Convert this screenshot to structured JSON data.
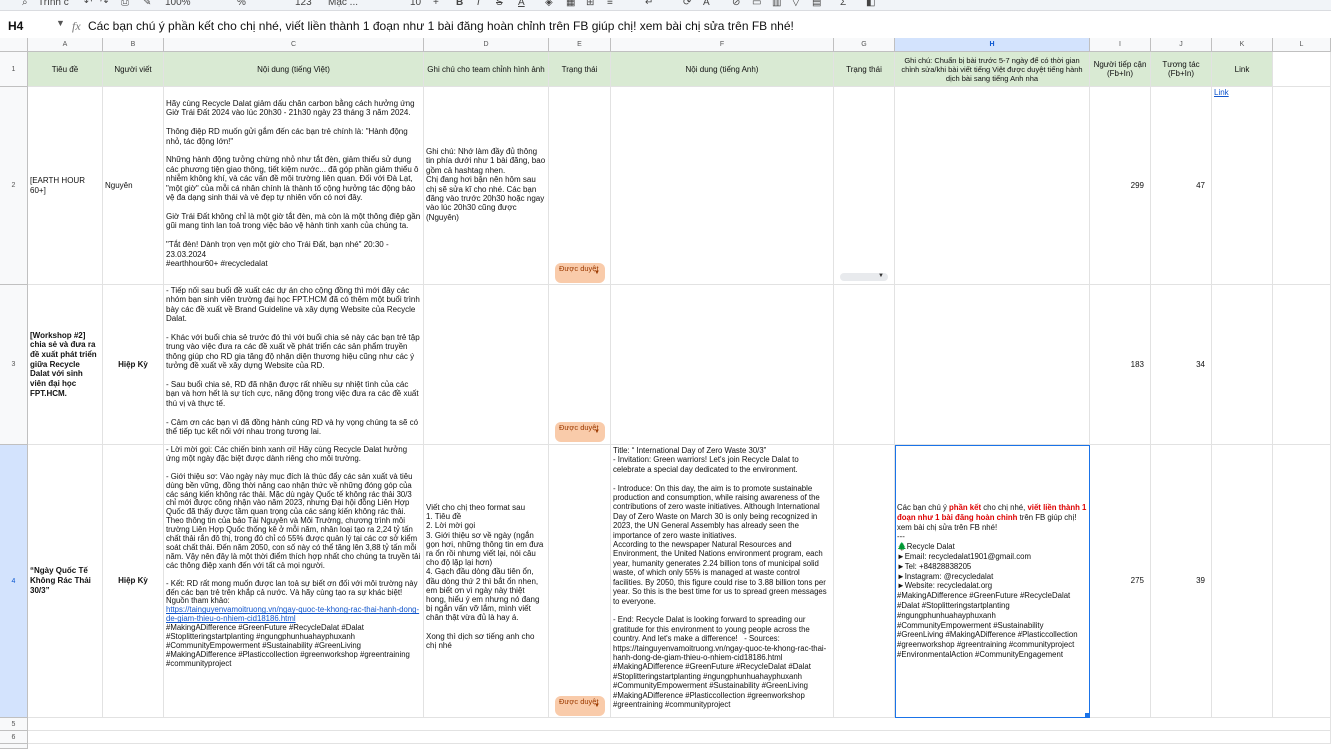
{
  "toolbar": {
    "search": "Trình c",
    "zoom": "100%",
    "font_family": "Mặc ...",
    "font_size": "10",
    "number_format": "123"
  },
  "formula_bar": {
    "cell_ref": "H4",
    "content": "Các bạn chú ý phần kết cho chị nhé, viết liền thành 1 đoạn như 1 bài đăng hoàn chỉnh trên FB giúp chị! xem bài chị sửa trên FB nhé!"
  },
  "columns": [
    "A",
    "B",
    "C",
    "D",
    "E",
    "F",
    "G",
    "H",
    "I",
    "J",
    "K",
    "L"
  ],
  "row_numbers": [
    "1",
    "2",
    "3",
    "4",
    "5",
    "6"
  ],
  "headers": {
    "A": "Tiêu đề",
    "B": "Người viết",
    "C": "Nội dung (tiếng Việt)",
    "D": "Ghi chú cho team chỉnh hình ảnh",
    "E": "Trạng thái",
    "F": "Nội dung (tiếng Anh)",
    "G": "Trạng thái",
    "H": "Ghi chú: Chuẩn bị bài trước 5-7 ngày để có thời gian chỉnh sửa/khi bài viết tiếng Việt được duyệt tiếng hành dịch bài sang tiếng Anh nha",
    "I": "Người tiếp cận (Fb+In)",
    "J": "Tương tác (Fb+In)",
    "K": "Link"
  },
  "rows": [
    {
      "title": "[EARTH HOUR 60+]",
      "writer": "Nguyên",
      "content_vi": "Hãy cùng Recycle Dalat giảm dấu chân carbon bằng cách hưởng ứng Giờ Trái Đất 2024 vào lúc 20h30 - 21h30 ngày 23 tháng 3 năm 2024.\n\nThông điệp RD muốn gửi gắm đến các bạn trẻ chính là: \"Hành động nhỏ, tác động lớn!\"\n\nNhững hành động tưởng chừng nhỏ như tắt đèn, giảm thiểu sử dụng các phương tiện giao thông, tiết kiệm nước... đã góp phần giảm thiểu ô nhiễm không khí, và các vấn đề môi trường liên quan. Đối với Đà Lạt, \"một giờ\" của mỗi cá nhân chính là thành tố cộng hưởng tác động bảo vệ đa dạng sinh thái và vẻ đẹp tự nhiên vốn có nơi đây.\n\nGiờ Trái Đất không chỉ là một giờ tắt đèn, mà còn là một thông điệp gần gũi mang tinh lan toả trong việc bảo vệ hành tinh xanh của chúng ta.\n\n\"Tắt đèn! Dành trọn vẹn một giờ cho Trái Đất, bạn nhé\" 20:30 - 23.03.2024\n#earthhour60+ #recycledalat",
      "note": "Ghi chú: Nhớ làm đầy đủ thông tin phía dưới như 1 bài đăng, bao gồm cả hashtag nhen.\nChị đang hơi bận nên hôm sau chị sẽ sửa kĩ cho nhé. Các bạn đăng vào trước 20h30 hoặc ngay vào lúc 20h30 cũng được\n(Nguyên)",
      "status": "Được duyệt",
      "content_en": "",
      "status_en": "",
      "note_h": "",
      "reach": "299",
      "interactions": "47",
      "link": "Link"
    },
    {
      "title": "[Workshop #2] chia sẻ và đưa ra đề xuất phát triển giữa Recycle Dalat với sinh viên đại học FPT.HCM.",
      "writer": "Hiệp Kỳ",
      "content_vi": "- Tiếp nối sau buổi đề xuất các dự án cho cộng đồng thì mới đây các nhóm bạn sinh viên trường đại học FPT.HCM đã có thêm một buổi trình bày các đề xuất về Brand Guideline và xây dựng Website của Recycle Dalat.\n\n- Khác với buổi chia sẻ trước đó thì với buổi chia sẻ này các bạn trẻ tập trung vào việc đưa ra các đề xuất về phát triển các sản phẩm truyền thông giúp cho RD gia tăng độ nhận diện thương hiệu cũng như các ý tưởng đề xuất về xây dựng Website của RD.\n\n- Sau buổi chia sẻ, RD đã nhận được rất nhiều sự nhiệt tình của các bạn và hơn hết là sự tích cực, năng động trong việc đưa ra các đề xuất thú vị và thực tế.\n\n- Cảm ơn các bạn vì đã đồng hành cùng RD và hy vọng chúng ta sẽ có thể tiếp tục kết nối với nhau trong tương lai.",
      "note": "",
      "status": "Được duyệt",
      "content_en": "",
      "status_en": "",
      "note_h": "",
      "reach": "183",
      "interactions": "34",
      "link": ""
    },
    {
      "title": "“Ngày Quốc Tế Không Rác Thải 30/3”",
      "writer": "Hiệp Kỳ",
      "content_vi": "- Lời mời gọi: Các chiến binh xanh ơi! Hãy cùng Recycle Dalat hưởng ứng một ngày đặc biệt được dành riêng cho môi trường.\n\n- Giới thiệu sơ: Vào ngày này mục đích là thúc đẩy các sản xuất và tiêu dùng bền vững, đồng thời nâng cao nhận thức về những đóng góp của các sáng kiến không rác thải. Mặc dù ngày Quốc tế không rác thải 30/3 chỉ mới được công nhận vào năm 2023, nhưng Đại hội đồng Liên Hợp Quốc đã thấy được tầm quan trọng của các sáng kiến không rác thải.\nTheo thông tin của báo Tài Nguyên và Môi Trường, chương trình môi trường Liên Hợp Quốc thống kê ở mỗi năm, nhân loại tạo ra 2,24 tỷ tấn chất thải rắn đô thị, trong đó chỉ có 55% được quản lý tại các cơ sở kiểm soát chất thải. Đến năm 2050, con số này có thể tăng lên 3,88 tỷ tấn mỗi năm. Vậy nên đây là một thời điểm thích hợp nhất cho chúng ta truyền tải các thông điệp xanh đến với tất cả mọi người.\n\n- Kết: RD rất mong muốn được lan toả sự biết ơn đối với môi trường này đến các bạn trẻ trên khắp cả nước. Và hãy cùng tạo ra sự khác biệt!\nNguồn tham khảo:",
      "source_link": "https://tainguyenvamoitruong.vn/ngay-quoc-te-khong-rac-thai-hanh-dong-de-giam-thieu-o-nhiem-cid18186.html",
      "content_vi_tags": "#MakingADifference #GreenFuture #RecycleDalat #Dalat #Stoplitteringstartplanting #ngungphunhuahayphuxanh #CommunityEmpowerment #Sustainability #GreenLiving #MakingADifference #Plasticcollection #greenworkshop #greentraining #communityproject",
      "note": "Viết cho chị theo format sau\n1. Tiêu đề\n2. Lời mời gọi\n3. Giới thiệu sơ về ngày (ngắn gọn hơi, những thông tin em đưa ra ổn rồi nhưng viết lại, nói câu cho độ lặp lại hơn)\n4. Gạch đầu dòng đầu tiên ổn, đầu dòng thứ 2 thì bắt ổn nhen, em biết ơn vì ngày này thiệt hong, hiểu ý em nhưng nó đang bị ngắn vấn vỡ lắm, mình viết chân thật vừa đủ là hay á.\n\nXong thì dịch sơ tiếng anh cho chị nhé",
      "status": "Được duyệt",
      "content_en": "Title: “ International Day of Zero Waste 30/3”\n- Invitation: Green warriors! Let's join Recycle Dalat to celebrate a special day dedicated to the environment.\n\n- Introduce: On this day, the aim is to promote sustainable production and consumption, while raising awareness of the contributions of zero waste initiatives. Although International Day of Zero Waste on March 30 is only being recognized in 2023, the UN General Assembly has already seen the importance of zero waste initiatives.\nAccording to the newspaper Natural Resources and Environment, the United Nations environment program, each year, humanity generates 2.24 billion tons of municipal solid waste, of which only 55% is managed at waste control facilities. By 2050, this figure could rise to 3.88 billion tons per year. So this is the best time for us to spread green messages to everyone.\n\n- End: Recycle Dalat is looking forward to spreading our gratitude for this environment to young people across the country. And let's make a difference!   - Sources: https://tainguyenvamoitruong.vn/ngay-quoc-te-khong-rac-thai-hanh-dong-de-giam-thieu-o-nhiem-cid18186.html\n#MakingADifference #GreenFuture #RecycleDalat #Dalat #Stoplitteringstartplanting #ngungphunhuahayphuxanh #CommunityEmpowerment #Sustainability #GreenLiving #MakingADifference #Plasticcollection #greenworkshop #greentraining #communityproject",
      "status_en": "",
      "note_h_pre": "Các bạn chú ý ",
      "note_h_red1": "phần kết",
      "note_h_mid": " cho chị nhé, ",
      "note_h_red2": "viết liền thành 1 đoạn như 1 bài đăng hoàn chỉnh",
      "note_h_post": " trên FB giúp chị! xem bài chị sửa trên FB nhé!\n---\n🌲Recycle Dalat\n►Email: recycledalat1901@gmail.com\n►Tel: +84828838205\n►Instagram: @recycledalat\n►Website: recycledalat.org\n#MakingADifference #GreenFuture #RecycleDalat #Dalat #Stoplitteringstartplanting #ngungphunhuahayphuxanh #CommunityEmpowerment #Sustainability #GreenLiving #MakingADifference #Plasticcollection #greenworkshop #greentraining #communityproject #EnvironmentalAction #CommunityEngagement",
      "reach": "275",
      "interactions": "39",
      "link": ""
    }
  ],
  "colors": {
    "header_green": "#d9ead3",
    "status_badge": "#f9cbaa",
    "selection_blue": "#1a73e8"
  }
}
